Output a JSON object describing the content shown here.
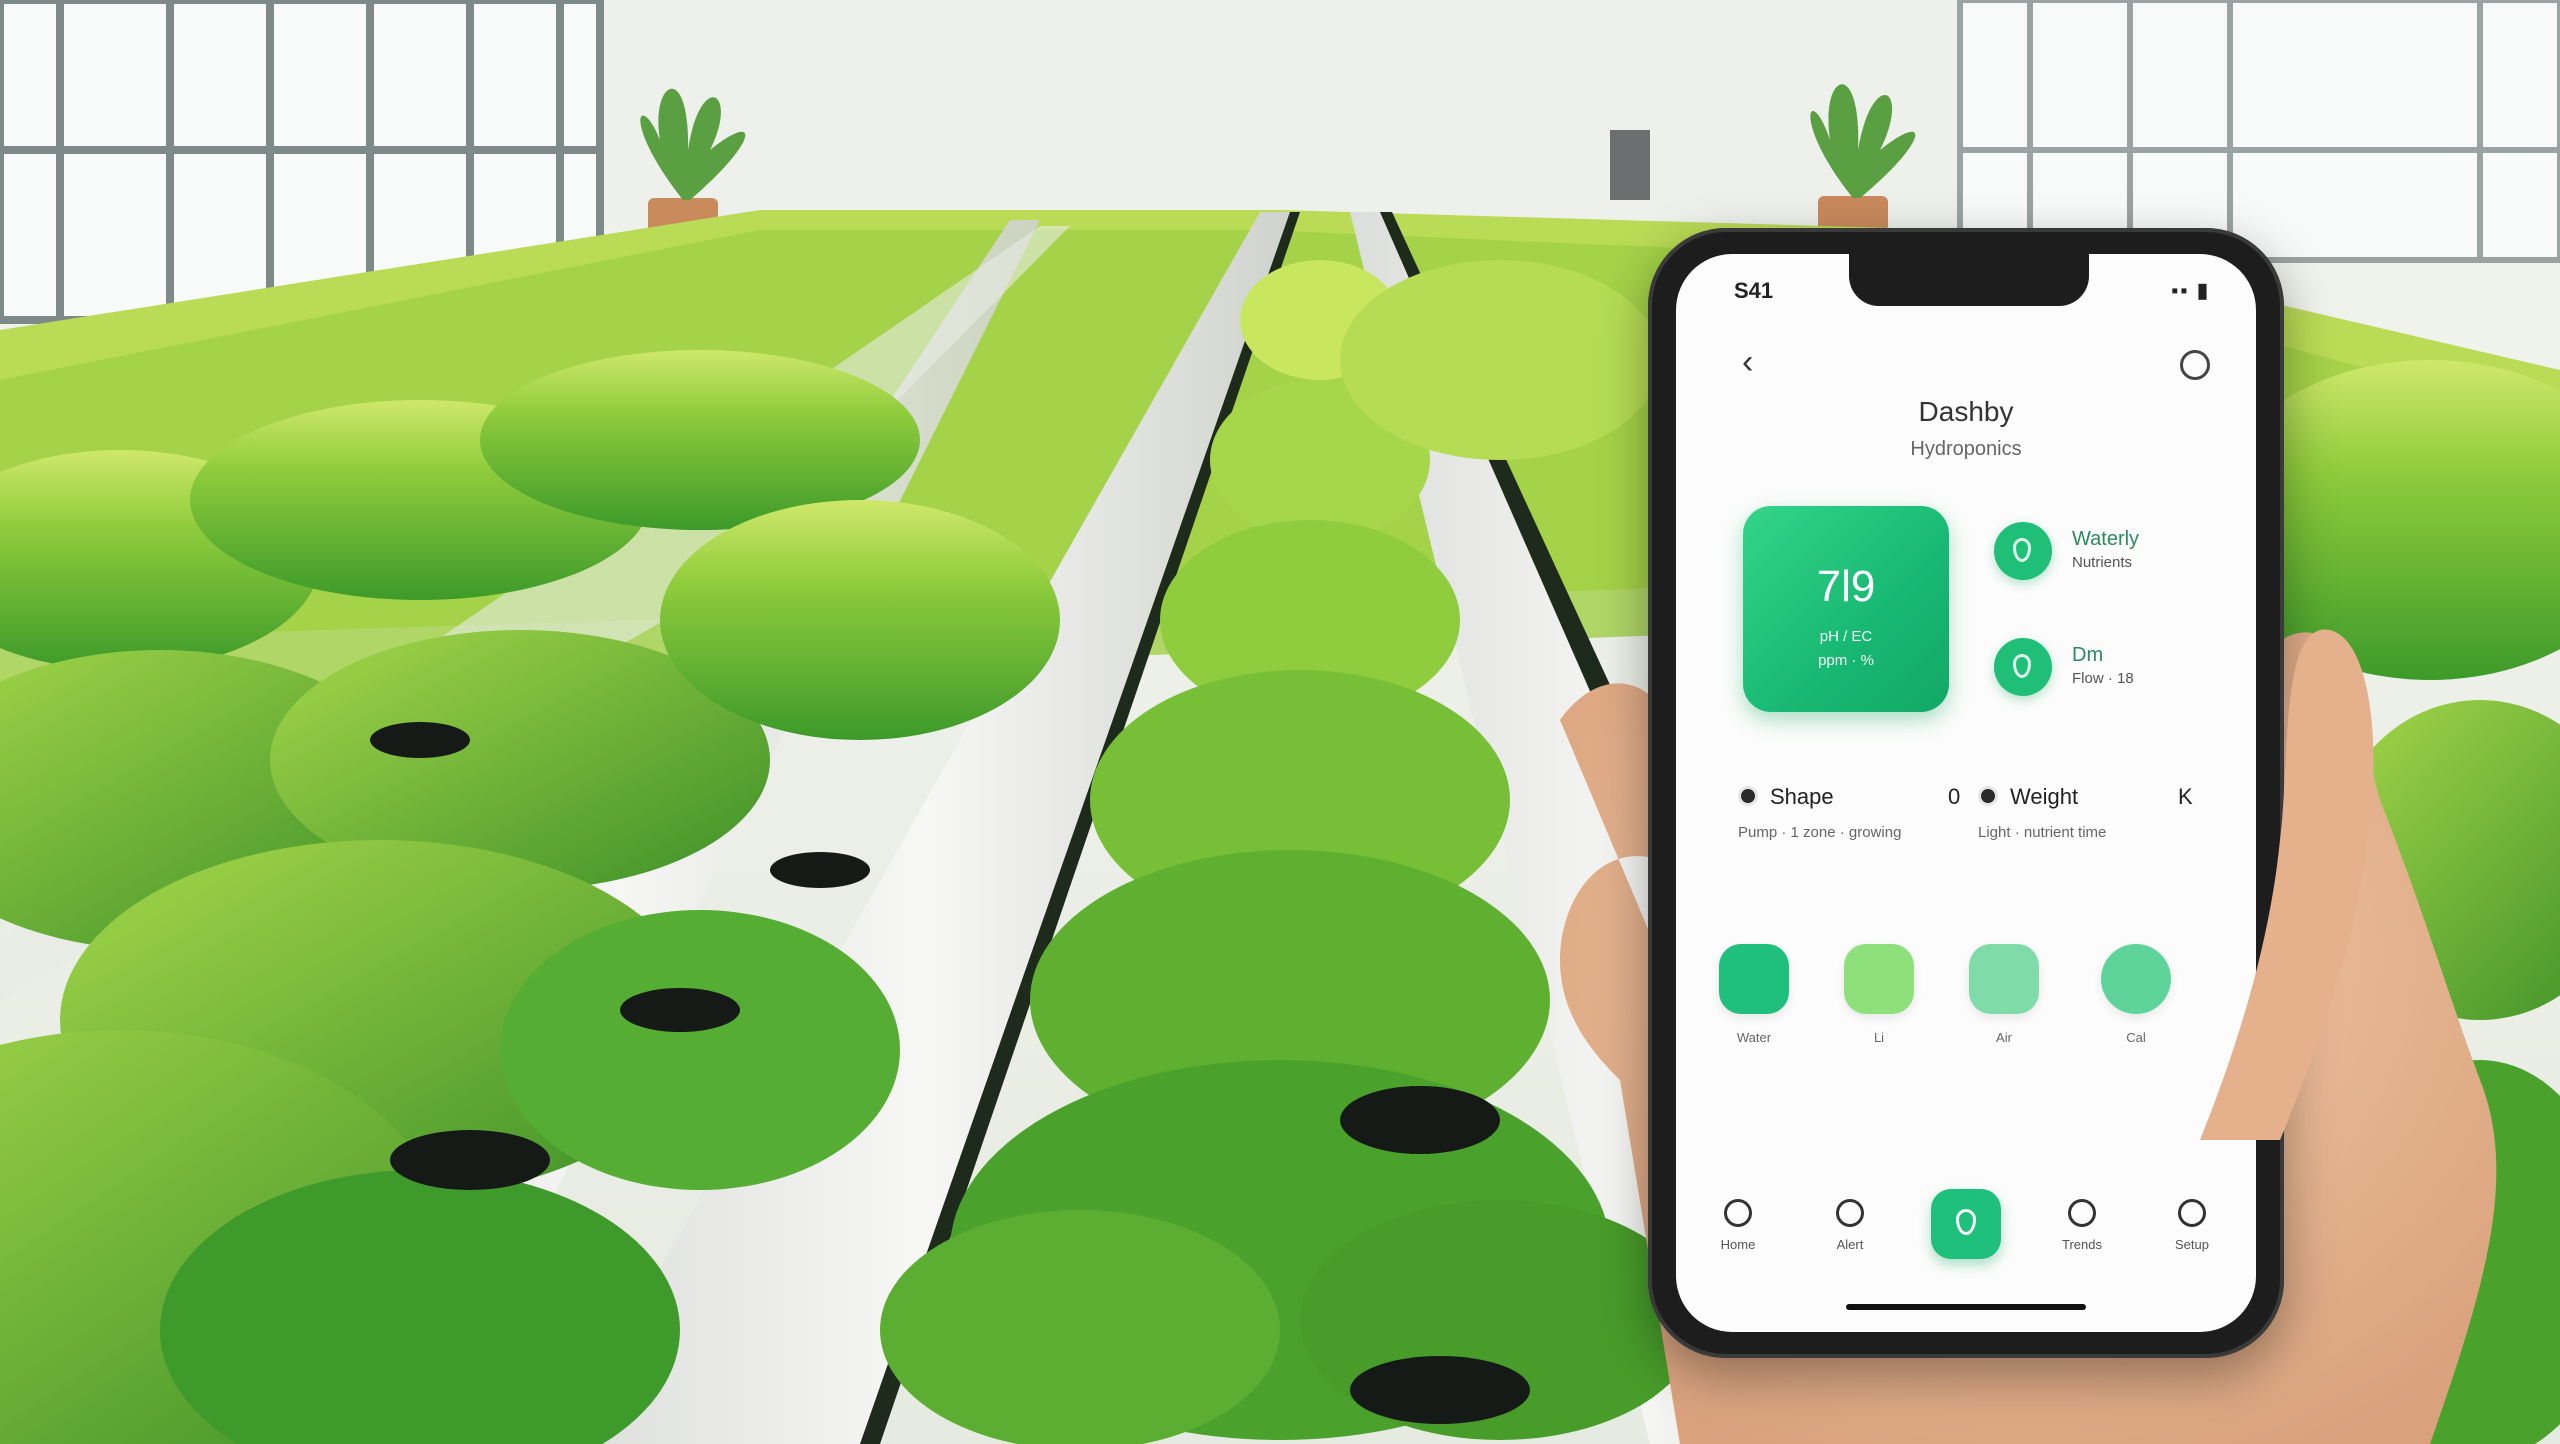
{
  "phone": {
    "status": {
      "time": "S41",
      "icons": "▪▪ ▮"
    },
    "header": {
      "title": "Dashby",
      "subtitle": "Hydroponics"
    },
    "main_card": {
      "value": "7l9",
      "label": "pH / EC",
      "unit": "ppm · %"
    },
    "side_items": [
      {
        "title": "Waterly",
        "detail": "Nutrients"
      },
      {
        "title": "Dm",
        "detail": "Flow · 18"
      }
    ],
    "stats": [
      {
        "title": "Shape",
        "detail": "Pump · 1 zone · growing",
        "trail": "0"
      },
      {
        "title": "Weight",
        "detail": "Light · nutrient time",
        "trail": "K"
      }
    ],
    "quick_actions": [
      {
        "label": "Water",
        "color": "#1ec07b"
      },
      {
        "label": "Li",
        "color": "#8ee07a"
      },
      {
        "label": "Air",
        "color": "#7fdba8"
      },
      {
        "label": "Cal",
        "color": "#5ed39a"
      }
    ],
    "tabs": [
      {
        "label": "Home"
      },
      {
        "label": "Alert"
      },
      {
        "label": ""
      },
      {
        "label": "Trends"
      },
      {
        "label": "Setup"
      }
    ]
  },
  "colors": {
    "accent": "#1ec07b",
    "accent_dark": "#12a866",
    "phone_body": "#1d1d1d"
  }
}
